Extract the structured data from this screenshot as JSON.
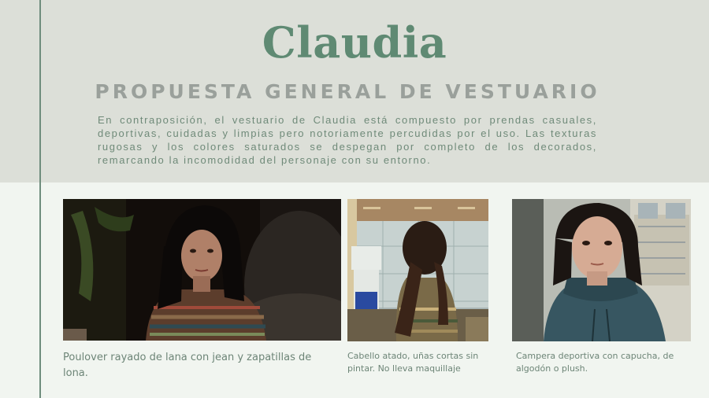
{
  "slide": {
    "title": "Claudia",
    "subtitle": "PROPUESTA GENERAL DE VESTUARIO",
    "description": "En contraposición, el vestuario de Claudia está compuesto por prendas casuales, deportivas, cuidadas y limpias pero notoriamente percudidas por el uso. Las texturas rugosas y los colores saturados se despegan por completo de los decorados, remarcando la incomodidad del personaje con su entorno."
  },
  "photos": [
    {
      "caption": "Poulover rayado de lana con jean y zapatillas de lona."
    },
    {
      "caption": "Cabello atado, uñas cortas sin pintar. No lleva maquillaje"
    },
    {
      "caption": "Campera deportiva con capucha, de algodón o plush."
    }
  ],
  "colors": {
    "accent": "#5f8a73",
    "top_band": "#dcdfd8",
    "bottom_band": "#f1f5f0",
    "subtitle": "#9aa09b",
    "text": "#6f8a79"
  }
}
